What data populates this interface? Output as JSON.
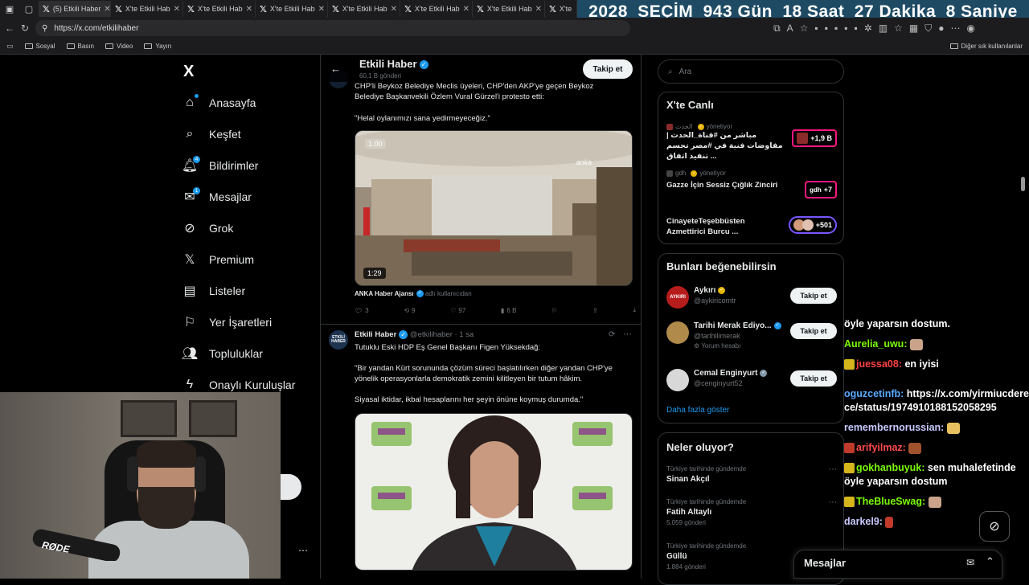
{
  "browser": {
    "tabs": [
      {
        "label": "(5) Etkili Haber",
        "active": true
      },
      {
        "label": "X'te Etkili Hab",
        "active": false
      },
      {
        "label": "X'te Etkili Hab",
        "active": false
      },
      {
        "label": "X'te Etkili Hab",
        "active": false
      },
      {
        "label": "X'te Etkili Hab",
        "active": false
      },
      {
        "label": "X'te Etkili Hab",
        "active": false
      },
      {
        "label": "X'te Etkili Hab",
        "active": false
      },
      {
        "label": "X'te",
        "active": false
      }
    ],
    "url": "https://x.com/etkilihaber",
    "bookmarks": [
      "Sosyal",
      "Basın",
      "Video",
      "Yayın"
    ],
    "other_bookmarks": "Diğer sık kullanılanlar"
  },
  "countdown": {
    "year": "2028",
    "label": "SEÇİM",
    "days": "943 Gün",
    "hours": "18 Saat",
    "minutes": "27 Dakika",
    "seconds": "8 Saniye"
  },
  "nav": {
    "logo": "X",
    "items": [
      {
        "label": "Anasayfa",
        "badge": ""
      },
      {
        "label": "Keşfet",
        "badge": ""
      },
      {
        "label": "Bildirimler",
        "badge": "4"
      },
      {
        "label": "Mesajlar",
        "badge": "1"
      },
      {
        "label": "Grok",
        "badge": ""
      },
      {
        "label": "Premium",
        "badge": ""
      },
      {
        "label": "Listeler",
        "badge": ""
      },
      {
        "label": "Yer İşaretleri",
        "badge": ""
      },
      {
        "label": "Topluluklar",
        "badge": ""
      },
      {
        "label": "Onaylı Kuruluşlar",
        "badge": ""
      }
    ]
  },
  "profile_header": {
    "name": "Etkili Haber",
    "posts": "60,1 B gönderi",
    "follow": "Takip et"
  },
  "tweet1": {
    "text_line1": "CHP'li Beykoz Belediye Meclis üyeleri, CHP'den AKP'ye geçen Beykoz",
    "text_line2": "Belediye Başkanvekili Özlem Vural Gürzel'i protesto etti:",
    "quote": "\"Helal oylanımızı sana yedirmeyeceğiz.\"",
    "video_speed": "1.00",
    "video_brand": "anka",
    "video_duration": "1:29",
    "source": "ANKA Haber Ajansı",
    "source_suffix": "adlı kullanıcıdan",
    "stats": {
      "replies": "3",
      "reposts": "9",
      "likes": "97",
      "views": "6 B"
    }
  },
  "tweet2": {
    "author": "Etkili Haber",
    "avatar_text": "ETKİLİ HABER",
    "handle": "@etkilihaber · 1 sa",
    "line1": "Tutuklu Eski HDP Eş Genel Başkanı Figen Yüksekdağ:",
    "line2": "\"Bir yandan Kürt sorununda çözüm süreci başlatılırken diğer yandan CHP'ye",
    "line3": "yönelik operasyonlarla demokratik zemini kilitleyen bir tutum hâkim.",
    "line4": "Siyasal iktidar, ikbal hesaplarını her şeyin önüne koymuş durumda.\""
  },
  "search": {
    "placeholder": "Ara"
  },
  "live": {
    "title": "X'te Canlı",
    "items": [
      {
        "host": "الحدث",
        "host_suffix": "yönetiyor",
        "title": "مباشر من #قناة_الحدث | مفاوضات فنية في #مصر تحسم تنفيذ اتفاق ...",
        "count": "+1,9 B"
      },
      {
        "host": "gdh",
        "host_suffix": "yönetiyor",
        "title": "Gazze İçin Sessiz Çığlık Zinciri",
        "count": "+7"
      },
      {
        "host": "",
        "host_suffix": "",
        "title": "CinayeteTeşebbüsten Azmettirici Burcu ...",
        "count": "+501"
      }
    ]
  },
  "suggestions": {
    "title": "Bunları beğenebilirsin",
    "button": "Takip et",
    "items": [
      {
        "name": "Aykırı",
        "handle": "@aykiricomtr",
        "extra": "",
        "avatar_text": "AYKIRI"
      },
      {
        "name": "Tarihi Merak Ediyo...",
        "handle": "@tarihilimerak",
        "extra": "Yorum hesabı",
        "avatar_text": ""
      },
      {
        "name": "Cemal Enginyurt",
        "handle": "@cenginyurt52",
        "extra": "",
        "avatar_text": ""
      }
    ],
    "more": "Daha fazla göster"
  },
  "trends": {
    "title": "Neler oluyor?",
    "items": [
      {
        "context": "Türkiye tarihinde gündemde",
        "name": "Sinan Akçıl",
        "count": ""
      },
      {
        "context": "Türkiye tarihinde gündemde",
        "name": "Fatih Altaylı",
        "count": "5.059 gönderi"
      },
      {
        "context": "Türkiye tarihinde gündemde",
        "name": "Güllü",
        "count": "1.884 gönderi"
      }
    ]
  },
  "chat": [
    {
      "user": "",
      "text": "öyle yaparsın dostum.",
      "color": "#ffffff"
    },
    {
      "user": "Aurelia_uwu:",
      "text": "",
      "color": "#7cfc00"
    },
    {
      "user": "juessa08:",
      "text": "en iyisi",
      "color": "#ff4040"
    },
    {
      "user": "oguzcetinfb:",
      "text": "https://x.com/yirmiucderece/status/1974910188152058295",
      "color": "#5aa9ff"
    },
    {
      "user": "remembernorussian:",
      "text": "",
      "color": "#c9c9ff"
    },
    {
      "user": "arifyilmaz:",
      "text": "",
      "color": "#ff4b4b"
    },
    {
      "user": "gokhanbuyuk:",
      "text": "sen muhalefetinde öyle yaparsın dostum",
      "color": "#7cfc00"
    },
    {
      "user": "TheBlueSwag:",
      "text": "",
      "color": "#7cfc00"
    },
    {
      "user": "darkel9:",
      "text": "",
      "color": "#c9c9ff"
    }
  ],
  "webcam": {
    "mic_brand": "RØDE"
  },
  "message_drawer": {
    "title": "Mesajlar"
  }
}
